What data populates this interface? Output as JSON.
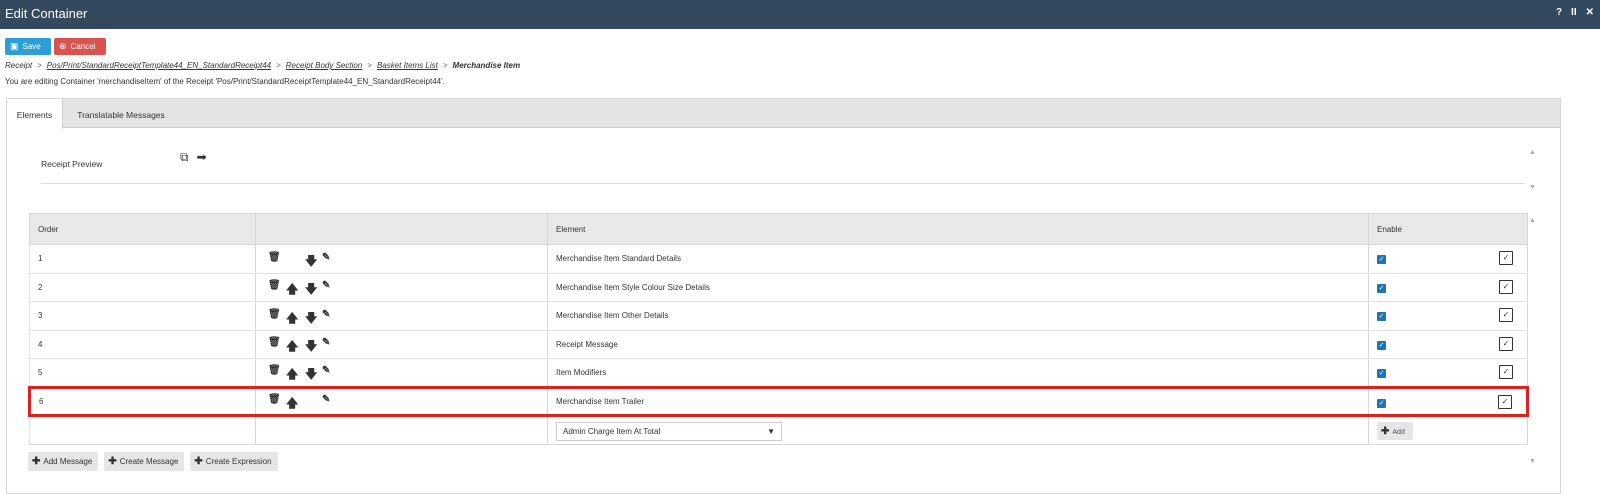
{
  "window": {
    "title": "Edit Container",
    "controls": [
      "?",
      "II",
      "✕"
    ]
  },
  "toolbar": {
    "save_label": "Save",
    "cancel_label": "Cancel"
  },
  "breadcrumb": {
    "items": [
      "Receipt",
      "Pos/Print/StandardReceiptTemplate44_EN_StandardReceipt44",
      "Receipt Body Section",
      "Basket Items List"
    ],
    "current": "Merchandise Item",
    "separator": ">"
  },
  "editing_note": "You are editing Container 'merchandiseItem' of the Receipt 'Pos/Print/StandardReceiptTemplate44_EN_StandardReceipt44'.",
  "tabs": {
    "elements": "Elements",
    "translatable": "Translatable Messages"
  },
  "preview": {
    "label": "Receipt Preview"
  },
  "table": {
    "headers": {
      "order": "Order",
      "actions": "",
      "element": "Element",
      "enable": "Enable"
    },
    "rows": [
      {
        "order": "1",
        "element": "Merchandise Item Standard Details",
        "enabled": true,
        "up": false,
        "down": true
      },
      {
        "order": "2",
        "element": "Merchandise Item Style Colour Size Details",
        "enabled": true,
        "up": true,
        "down": true
      },
      {
        "order": "3",
        "element": "Merchandise Item Other Details",
        "enabled": true,
        "up": true,
        "down": true
      },
      {
        "order": "4",
        "element": "Receipt Message",
        "enabled": true,
        "up": true,
        "down": true
      },
      {
        "order": "5",
        "element": "Item Modifiers",
        "enabled": true,
        "up": true,
        "down": true
      },
      {
        "order": "6",
        "element": "Merchandise Item Trailer",
        "enabled": true,
        "up": true,
        "down": false,
        "highlighted": true
      }
    ],
    "new_element_select": "Admin Charge Item At Total",
    "add_label": "Add"
  },
  "footer": {
    "add_message": "Add Message",
    "create_message": "Create Message",
    "create_expression": "Create Expression"
  },
  "colors": {
    "titlebar": "#34495e",
    "save": "#2d9fd6",
    "cancel": "#d9534f",
    "highlight": "#dd2222",
    "checkbox": "#2173b8"
  }
}
